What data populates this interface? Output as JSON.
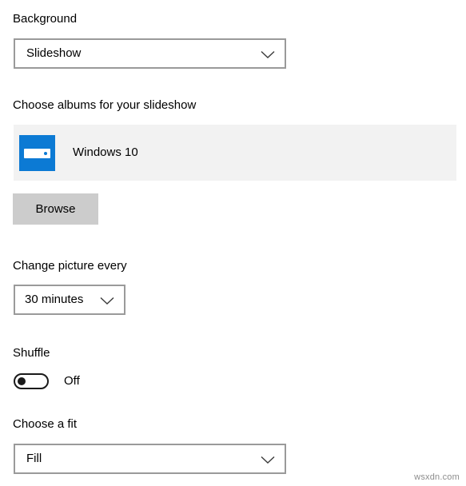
{
  "page": {
    "watermark": "wsxdn.com"
  },
  "background_section": {
    "label": "Background",
    "dropdown": {
      "value": "Slideshow",
      "icon": "chevron-down-icon"
    }
  },
  "albums_section": {
    "label": "Choose albums for your slideshow",
    "items": [
      {
        "name": "Windows 10",
        "icon": "folder-thumbnail-icon"
      }
    ],
    "browse_button": "Browse"
  },
  "interval_section": {
    "label": "Change picture every",
    "dropdown": {
      "value": "30 minutes",
      "icon": "chevron-down-icon"
    }
  },
  "shuffle_section": {
    "label": "Shuffle",
    "state": "Off"
  },
  "fit_section": {
    "label": "Choose a fit",
    "dropdown": {
      "value": "Fill",
      "icon": "chevron-down-icon"
    }
  }
}
